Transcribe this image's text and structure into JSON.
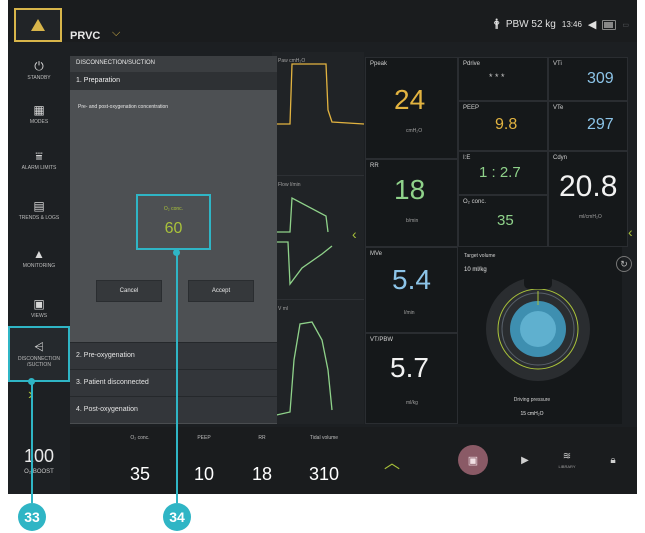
{
  "header": {
    "mode": "PRVC",
    "pbw": "PBW 52 kg",
    "time": "13:46"
  },
  "sidebar": {
    "items": [
      {
        "id": "standby",
        "label": "STANDBY"
      },
      {
        "id": "modes",
        "label": "MODES"
      },
      {
        "id": "alarm-limits",
        "label": "ALARM LIMITS"
      },
      {
        "id": "trends-logs",
        "label": "TRENDS & LOGS"
      },
      {
        "id": "monitoring",
        "label": "MONITORING"
      },
      {
        "id": "views",
        "label": "VIEWS"
      },
      {
        "id": "disconnection",
        "label": "DISCONNECTION /SUCTION"
      }
    ]
  },
  "dialog": {
    "title": "DISCONNECTION/SUCTION",
    "step1": "1. Preparation",
    "body_text": "Pre- and post-oxygenation concentration",
    "o2_label": "O₂ conc.",
    "o2_value": "60",
    "cancel": "Cancel",
    "accept": "Accept",
    "step2": "2. Pre-oxygenation",
    "step3": "3. Patient disconnected",
    "step4": "4. Post-oxygenation"
  },
  "waveforms": {
    "pressure_label": "Paw cmH₂O",
    "flow_label": "Flow l/min",
    "volume_label": "V ml"
  },
  "parameters": {
    "ppeak_label": "Ppeak",
    "ppeak_value": "24",
    "ppeak_unit": "cmH₂O",
    "rr_label": "RR",
    "rr_value": "18",
    "rr_unit": "b/min",
    "mve_label": "MVe",
    "mve_value": "5.4",
    "mve_unit": "l/min",
    "vtpbw_label": "VT/PBW",
    "vtpbw_value": "5.7",
    "vtpbw_unit": "ml/kg",
    "pdrive_label": "Pdrive",
    "pdrive_value": "* * *",
    "peep_label": "PEEP",
    "peep_value": "9.8",
    "ie_label": "I:E",
    "ie_value": "1 : 2.7",
    "o2conc_label": "O₂ conc.",
    "o2conc_value": "35",
    "vti_label": "VTi",
    "vti_value": "309",
    "vte_label": "VTe",
    "vte_value": "297",
    "cdyn_label": "Cdyn",
    "cdyn_value": "20.8",
    "cdyn_unit": "ml/cmH₂O",
    "target_label": "Target volume",
    "target_value": "10 ml/kg",
    "driving_label": "Driving pressure",
    "driving_value": "15 cmH₂O"
  },
  "bottom": {
    "o2boost_value": "100",
    "o2boost_label": "O₂ BOOST",
    "settings": [
      {
        "label": "O₂ conc.",
        "value": "35"
      },
      {
        "label": "PEEP",
        "value": "10"
      },
      {
        "label": "RR",
        "value": "18"
      },
      {
        "label": "Tidal volume",
        "value": "310"
      }
    ],
    "library_label": "LIBRARY"
  },
  "callouts": {
    "c33": "33",
    "c34": "34"
  },
  "colors": {
    "accent_callout": "#2fb5c5",
    "accent_green": "#a9c23a",
    "alarm_yellow": "#d8b54a",
    "pressure_orange": "#e2b340",
    "flow_green": "#8fd28a",
    "volume_blue": "#8cc4e8"
  }
}
